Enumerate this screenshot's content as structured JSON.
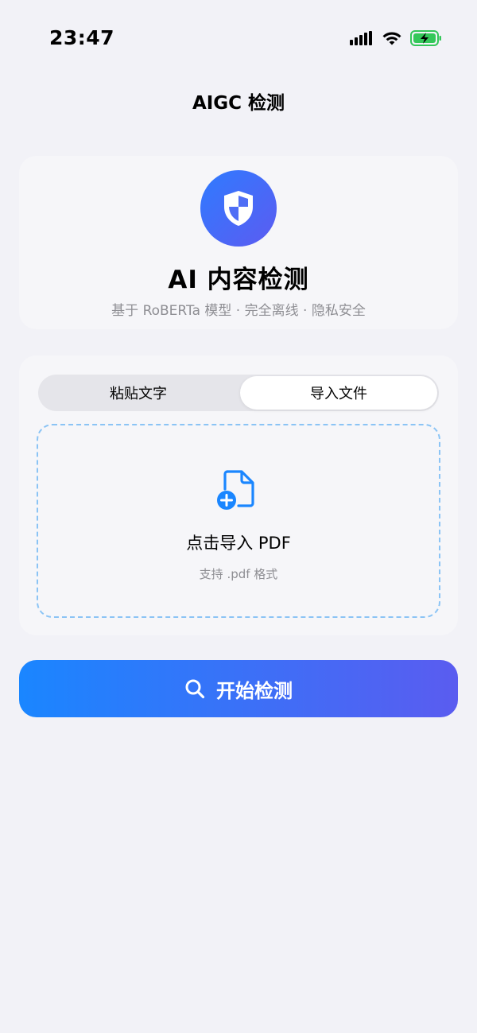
{
  "status_bar": {
    "time": "23:47",
    "icons": [
      "cellular-signal-icon",
      "wifi-icon",
      "battery-charging-icon"
    ],
    "battery_color": "#34C759"
  },
  "nav": {
    "title": "AIGC 检测"
  },
  "hero": {
    "icon": "shield-icon",
    "title": "AI 内容检测",
    "subtitle": "基于 RoBERTa 模型 · 完全离线 · 隐私安全"
  },
  "mode_tabs": {
    "items": [
      {
        "label": "粘贴文字",
        "selected": false
      },
      {
        "label": "导入文件",
        "selected": true
      }
    ]
  },
  "dropzone": {
    "icon": "document-add-icon",
    "title": "点击导入 PDF",
    "hint": "支持 .pdf 格式"
  },
  "start_button": {
    "icon": "search-icon",
    "label": "开始检测"
  },
  "colors": {
    "background": "#F2F2F7",
    "accent_start": "#1A86FF",
    "accent_end": "#5A5CF0",
    "dropzone_border": "#8BC4F5",
    "secondary_text": "#8E8E93"
  }
}
